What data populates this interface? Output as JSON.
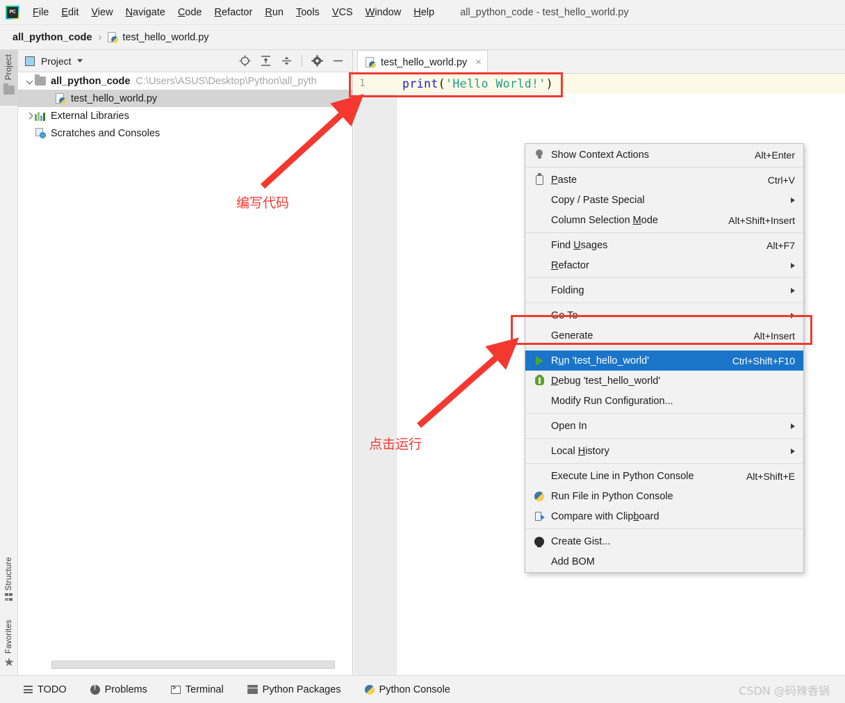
{
  "window": {
    "title": "all_python_code - test_hello_world.py"
  },
  "menubar": {
    "items": [
      {
        "label": "File",
        "pre": "F",
        "rest": "ile"
      },
      {
        "label": "Edit",
        "pre": "E",
        "rest": "dit"
      },
      {
        "label": "View",
        "pre": "V",
        "rest": "iew"
      },
      {
        "label": "Navigate",
        "pre": "N",
        "rest": "avigate"
      },
      {
        "label": "Code",
        "pre": "C",
        "rest": "ode"
      },
      {
        "label": "Refactor",
        "pre": "R",
        "rest": "efactor"
      },
      {
        "label": "Run",
        "pre": "R",
        "rest": "un"
      },
      {
        "label": "Tools",
        "pre": "T",
        "rest": "ools"
      },
      {
        "label": "VCS",
        "pre": "V",
        "rest": "CS"
      },
      {
        "label": "Window",
        "pre": "W",
        "rest": "indow"
      },
      {
        "label": "Help",
        "pre": "H",
        "rest": "elp"
      }
    ]
  },
  "breadcrumb": {
    "project": "all_python_code",
    "separator": "›",
    "file": "test_hello_world.py"
  },
  "toolstrip": {
    "project_label": "Project",
    "structure_label": "Structure",
    "favorites_label": "Favorites"
  },
  "project_panel": {
    "title": "Project",
    "tools": [
      "locate-icon",
      "expand-all-icon",
      "collapse-all-icon",
      "settings-icon",
      "hide-icon"
    ],
    "tree": [
      {
        "name": "all_python_code",
        "path": "C:\\Users\\ASUS\\Desktop\\Python\\all_pyth",
        "icon": "folder-icon",
        "expanded": true,
        "selected": false,
        "indent": 0
      },
      {
        "name": "test_hello_world.py",
        "path": "",
        "icon": "python-file-icon",
        "expanded": null,
        "selected": true,
        "indent": 1
      },
      {
        "name": "External Libraries",
        "path": "",
        "icon": "libraries-icon",
        "expanded": false,
        "selected": false,
        "indent": 0
      },
      {
        "name": "Scratches and Consoles",
        "path": "",
        "icon": "scratches-icon",
        "expanded": null,
        "selected": false,
        "indent": 0
      }
    ]
  },
  "editor": {
    "tab": {
      "label": "test_hello_world.py",
      "close": "×"
    },
    "line_number": "1",
    "code": {
      "fn": "print",
      "open": "(",
      "string": "'Hello World!'",
      "close": ")"
    }
  },
  "context_menu": {
    "items": [
      {
        "type": "item",
        "label": "Show Context Actions",
        "pre": "",
        "u": "",
        "post": "Show Context Actions",
        "shortcut": "Alt+Enter",
        "icon": "lightbulb-icon",
        "submenu": false,
        "highlighted": false
      },
      {
        "type": "divider"
      },
      {
        "type": "item",
        "label": "Paste",
        "pre": "",
        "u": "P",
        "post": "aste",
        "shortcut": "Ctrl+V",
        "icon": "clipboard-icon",
        "submenu": false,
        "highlighted": false
      },
      {
        "type": "item",
        "label": "Copy / Paste Special",
        "pre": "Copy / Paste Special",
        "u": "",
        "post": "",
        "shortcut": "",
        "icon": "",
        "submenu": true,
        "highlighted": false
      },
      {
        "type": "item",
        "label": "Column Selection Mode",
        "pre": "Column Selection ",
        "u": "M",
        "post": "ode",
        "shortcut": "Alt+Shift+Insert",
        "icon": "",
        "submenu": false,
        "highlighted": false
      },
      {
        "type": "divider"
      },
      {
        "type": "item",
        "label": "Find Usages",
        "pre": "Find ",
        "u": "U",
        "post": "sages",
        "shortcut": "Alt+F7",
        "icon": "",
        "submenu": false,
        "highlighted": false
      },
      {
        "type": "item",
        "label": "Refactor",
        "pre": "",
        "u": "R",
        "post": "efactor",
        "shortcut": "",
        "icon": "",
        "submenu": true,
        "highlighted": false
      },
      {
        "type": "divider"
      },
      {
        "type": "item",
        "label": "Folding",
        "pre": "Folding",
        "u": "",
        "post": "",
        "shortcut": "",
        "icon": "",
        "submenu": true,
        "highlighted": false
      },
      {
        "type": "divider"
      },
      {
        "type": "item",
        "label": "Go To",
        "pre": "Go To",
        "u": "",
        "post": "",
        "shortcut": "",
        "icon": "",
        "submenu": true,
        "highlighted": false
      },
      {
        "type": "item",
        "label": "Generate",
        "pre": "Generate",
        "u": "",
        "post": "",
        "shortcut": "Alt+Insert",
        "icon": "",
        "submenu": false,
        "highlighted": false
      },
      {
        "type": "divider"
      },
      {
        "type": "item",
        "label": "Run 'test_hello_world'",
        "pre": "R",
        "u": "u",
        "post": "n 'test_hello_world'",
        "shortcut": "Ctrl+Shift+F10",
        "icon": "run-icon",
        "submenu": false,
        "highlighted": true
      },
      {
        "type": "item",
        "label": "Debug 'test_hello_world'",
        "pre": "",
        "u": "D",
        "post": "ebug 'test_hello_world'",
        "shortcut": "",
        "icon": "debug-icon",
        "submenu": false,
        "highlighted": false
      },
      {
        "type": "item",
        "label": "Modify Run Configuration...",
        "pre": "Modify Run Configuration...",
        "u": "",
        "post": "",
        "shortcut": "",
        "icon": "",
        "submenu": false,
        "highlighted": false
      },
      {
        "type": "divider"
      },
      {
        "type": "item",
        "label": "Open In",
        "pre": "Open In",
        "u": "",
        "post": "",
        "shortcut": "",
        "icon": "",
        "submenu": true,
        "highlighted": false
      },
      {
        "type": "divider"
      },
      {
        "type": "item",
        "label": "Local History",
        "pre": "Local ",
        "u": "H",
        "post": "istory",
        "shortcut": "",
        "icon": "",
        "submenu": true,
        "highlighted": false
      },
      {
        "type": "divider"
      },
      {
        "type": "item",
        "label": "Execute Line in Python Console",
        "pre": "Execute Line in Python Console",
        "u": "",
        "post": "",
        "shortcut": "Alt+Shift+E",
        "icon": "",
        "submenu": false,
        "highlighted": false
      },
      {
        "type": "item",
        "label": "Run File in Python Console",
        "pre": "Run File in Python Console",
        "u": "",
        "post": "",
        "shortcut": "",
        "icon": "python-icon",
        "submenu": false,
        "highlighted": false
      },
      {
        "type": "item",
        "label": "Compare with Clipboard",
        "pre": "Compare with Clip",
        "u": "b",
        "post": "oard",
        "shortcut": "",
        "icon": "compare-icon",
        "submenu": false,
        "highlighted": false
      },
      {
        "type": "divider"
      },
      {
        "type": "item",
        "label": "Create Gist...",
        "pre": "Create Gist...",
        "u": "",
        "post": "",
        "shortcut": "",
        "icon": "github-icon",
        "submenu": false,
        "highlighted": false
      },
      {
        "type": "item",
        "label": "Add BOM",
        "pre": "Add BOM",
        "u": "",
        "post": "",
        "shortcut": "",
        "icon": "",
        "submenu": false,
        "highlighted": false
      }
    ]
  },
  "annotations": {
    "write_code": "编写代码",
    "click_run": "点击运行",
    "color": "#f4382f"
  },
  "bottombar": {
    "items": [
      {
        "label": "TODO",
        "icon": "todo-icon"
      },
      {
        "label": "Problems",
        "icon": "problems-icon"
      },
      {
        "label": "Terminal",
        "icon": "terminal-icon"
      },
      {
        "label": "Python Packages",
        "icon": "packages-icon"
      },
      {
        "label": "Python Console",
        "icon": "python-console-icon"
      }
    ],
    "watermark": "CSDN @码辣香锅"
  }
}
